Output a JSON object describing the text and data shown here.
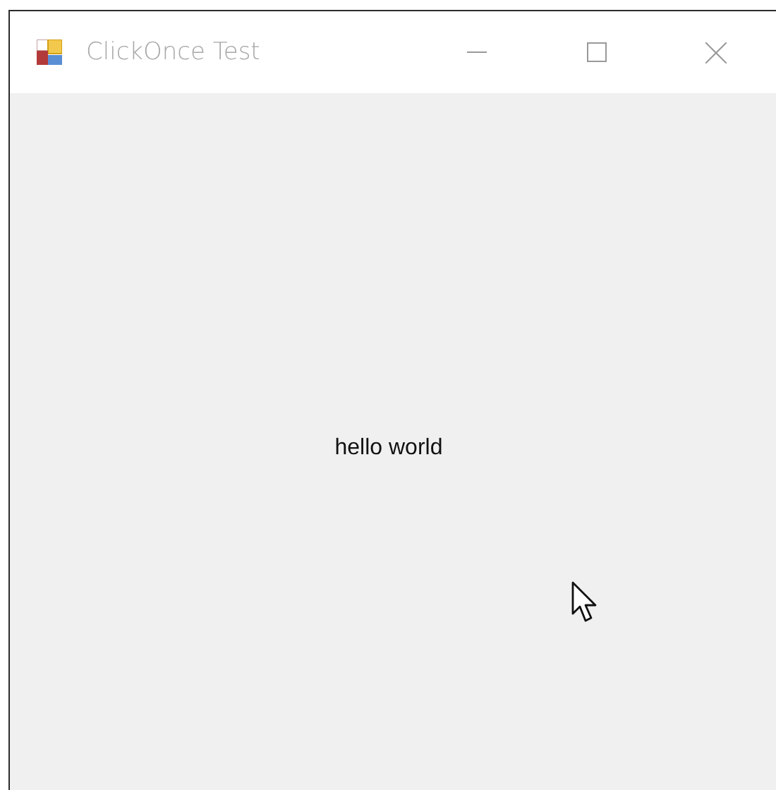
{
  "window": {
    "title": "ClickOnce Test"
  },
  "content": {
    "label": "hello world"
  }
}
